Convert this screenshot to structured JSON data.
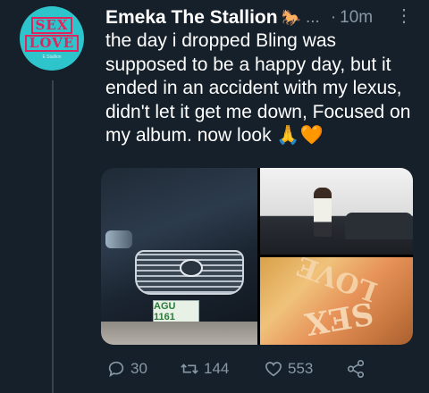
{
  "tweet": {
    "author_name": "Emeka The Stallion",
    "author_emoji": "🐎",
    "name_ellipsis": "...",
    "separator": "·",
    "time": "10m",
    "more_label": "⋮",
    "text": "the day i dropped Bling was supposed to be a happy day, but it ended in an accident with my lexus, didn't let it get me down, Focused on my album. now look",
    "text_emojis": [
      "🙏",
      "🧡"
    ]
  },
  "avatar": {
    "logo_lines": [
      "SEX",
      "LOVE"
    ],
    "logo_sub": "E Stallion",
    "bg_color": "#2ec4cc",
    "logo_color": "#e0245e"
  },
  "media": {
    "plate_text": "AGU 1161",
    "album_text": [
      "LOVE",
      "SEX"
    ]
  },
  "actions": {
    "reply_count": "30",
    "retweet_count": "144",
    "like_count": "553"
  },
  "colors": {
    "background": "#15202b",
    "secondary_text": "#8899a6",
    "primary_text": "#ffffff"
  }
}
